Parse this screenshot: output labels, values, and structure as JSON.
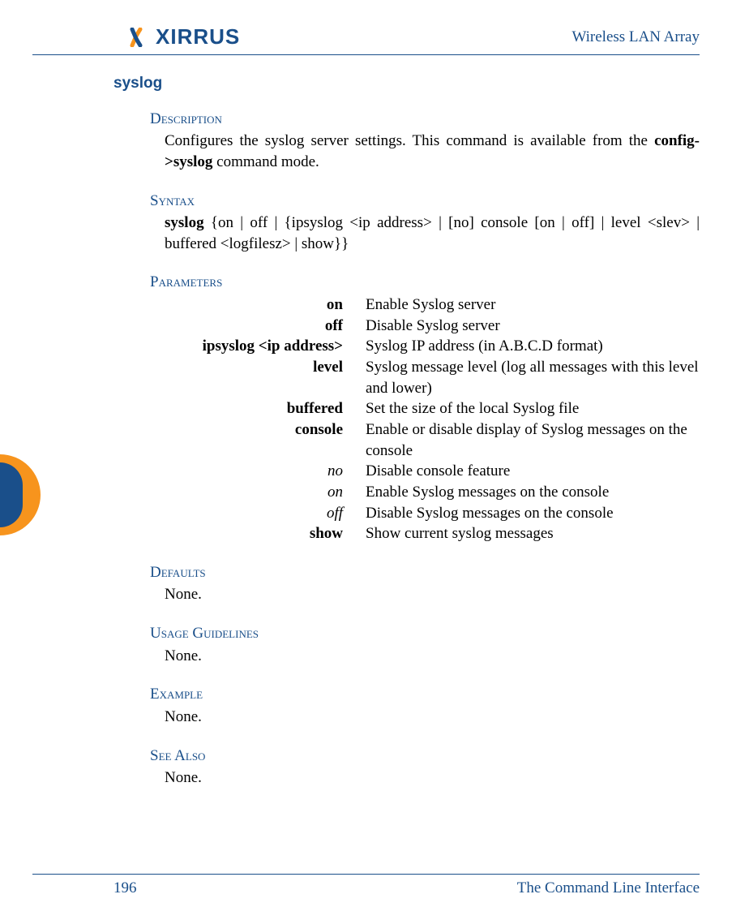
{
  "header": {
    "logo_text": "XIRRUS",
    "title": "Wireless LAN Array"
  },
  "section_title": "syslog",
  "description": {
    "label": "Description",
    "text_before": "Configures the  syslog server settings. This command is available from the ",
    "bold": "config->syslog",
    "text_after": " command mode."
  },
  "syntax": {
    "label": "Syntax",
    "cmd": "syslog",
    "rest": " {on | off | {ipsyslog <ip address> | [no] console [on | off] | level <slev> | buffered <logfilesz> | show}}"
  },
  "parameters": {
    "label": "Parameters",
    "rows": [
      {
        "key": "on",
        "style": "bold",
        "val": "Enable Syslog server"
      },
      {
        "key": "off",
        "style": "bold",
        "val": "Disable Syslog server"
      },
      {
        "key": "ipsyslog <ip address>",
        "style": "bold",
        "val": "Syslog IP address (in A.B.C.D format)"
      },
      {
        "key": "level",
        "style": "bold",
        "val": "Syslog message level (log all messages with this level and lower)"
      },
      {
        "key": "buffered",
        "style": "bold",
        "val": "Set the size of the local Syslog file"
      },
      {
        "key": "console",
        "style": "bold",
        "val": "Enable or disable display of Syslog messages on the console"
      },
      {
        "key": "no",
        "style": "italic",
        "val": "Disable console feature"
      },
      {
        "key": "on",
        "style": "italic",
        "val": "Enable Syslog messages on the console"
      },
      {
        "key": "off",
        "style": "italic",
        "val": "Disable Syslog messages on the console"
      },
      {
        "key": "show",
        "style": "bold",
        "val": "Show current syslog messages"
      }
    ]
  },
  "defaults": {
    "label": "Defaults",
    "body": "None."
  },
  "usage": {
    "label": "Usage Guidelines",
    "body": "None."
  },
  "example": {
    "label": "Example",
    "body": "None."
  },
  "seealso": {
    "label": "See Also",
    "body": "None."
  },
  "footer": {
    "page": "196",
    "chapter": "The Command Line Interface"
  }
}
